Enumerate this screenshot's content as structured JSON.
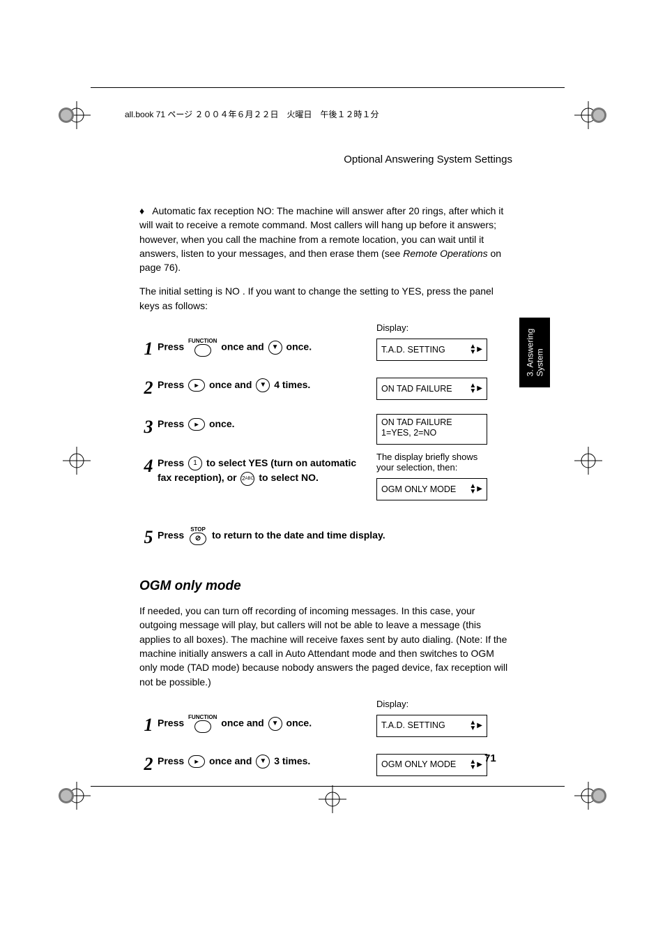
{
  "crop_header": "all.book  71 ページ  ２００４年６月２２日　火曜日　午後１２時１分",
  "section_header": "Optional Answering System Settings",
  "bullet_text": "Automatic fax reception NO: The machine will answer after 20 rings, after which it will wait to receive a remote command. Most callers will hang up before it answers; however, when you call the machine from a remote location, you can wait until it answers, listen to your messages, and then erase them (see ",
  "bullet_text_italic": "Remote Operations",
  "bullet_text_tail": " on page 76).",
  "intro_text": "The initial setting is NO . If you want to change the setting to YES, press the panel keys as follows:",
  "display_label": "Display:",
  "steps1": {
    "s1": {
      "num": "1",
      "t1": "Press ",
      "key1_label": "FUNCTION",
      "t2": " once and ",
      "t3": " once.",
      "display": "T.A.D. SETTING"
    },
    "s2": {
      "num": "2",
      "t1": "Press ",
      "t2": " once and ",
      "t3": " 4 times.",
      "display": "ON TAD FAILURE"
    },
    "s3": {
      "num": "3",
      "t1": "Press ",
      "t2": " once.",
      "display_l1": "ON TAD FAILURE",
      "display_l2": "1=YES, 2=NO"
    },
    "s4": {
      "num": "4",
      "t1": "Press ",
      "key1_inner": "1",
      "t2": " to select YES (turn on automatic fax reception), or ",
      "key2_inner": "2",
      "key2_sub": "ABC",
      "t3": " to select NO.",
      "note": "The display briefly shows your selection, then:",
      "display": "OGM ONLY MODE"
    },
    "s5": {
      "num": "5",
      "t1": "Press ",
      "key1_label": "STOP",
      "t2": " to return to the date and time display."
    }
  },
  "subtitle": "OGM only mode",
  "ogm_text": "If needed, you can turn off recording of incoming messages. In this case, your outgoing message will play, but callers will not be able to leave a message (this applies to all boxes). The machine will receive faxes sent by auto dialing. (Note: If the machine initially answers a call in Auto Attendant mode and then switches to OGM only mode (TAD mode) because nobody answers the paged device, fax reception will not be possible.)",
  "steps2": {
    "s1": {
      "num": "1",
      "t1": "Press ",
      "key1_label": "FUNCTION",
      "t2": " once and ",
      "t3": " once.",
      "display": "T.A.D. SETTING"
    },
    "s2": {
      "num": "2",
      "t1": "Press ",
      "t2": " once and ",
      "t3": " 3 times.",
      "display": "OGM ONLY MODE"
    }
  },
  "side_tab_l1": "3. Answering",
  "side_tab_l2": "System",
  "page_number": "71"
}
